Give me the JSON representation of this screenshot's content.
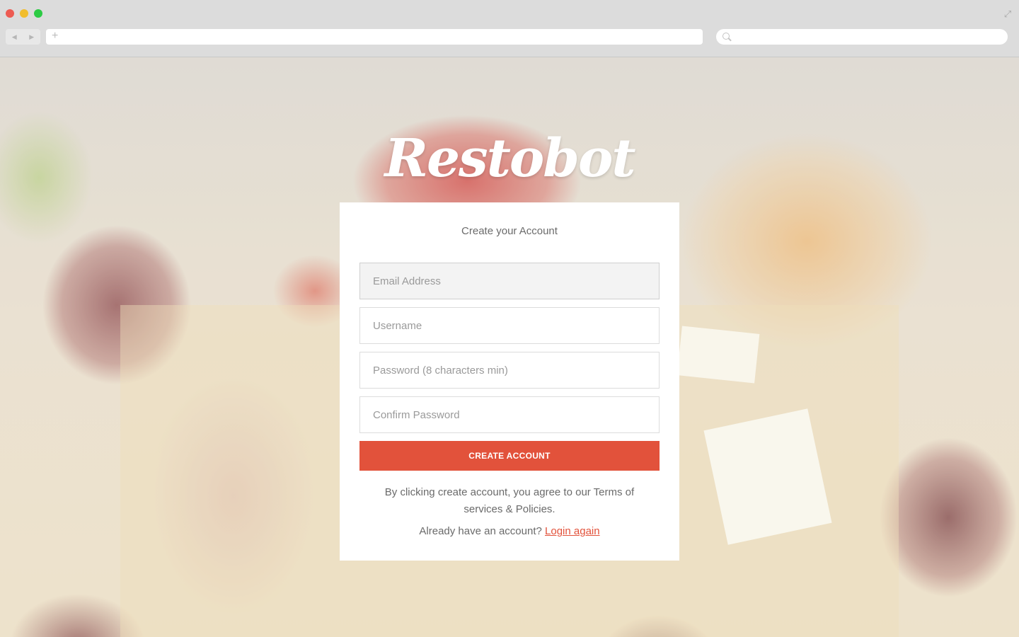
{
  "browser": {
    "back_glyph": "◀",
    "forward_glyph": "▶",
    "new_tab_glyph": "+",
    "expand_glyph": "⤢",
    "address": "",
    "search": ""
  },
  "brand": {
    "logo_text": "Restobot"
  },
  "form": {
    "title": "Create your Account",
    "email_placeholder": "Email Address",
    "username_placeholder": "Username",
    "password_placeholder": "Password (8 characters min)",
    "confirm_placeholder": "Confirm Password",
    "submit_label": "CREATE ACCOUNT",
    "terms_text": "By clicking create account, you agree to our Terms of services & Policies.",
    "login_prompt": "Already have an account?",
    "login_link": "Login again"
  },
  "colors": {
    "accent": "#e2523b",
    "card_bg": "#ffffff",
    "chrome_bg": "#dcdcdc"
  }
}
